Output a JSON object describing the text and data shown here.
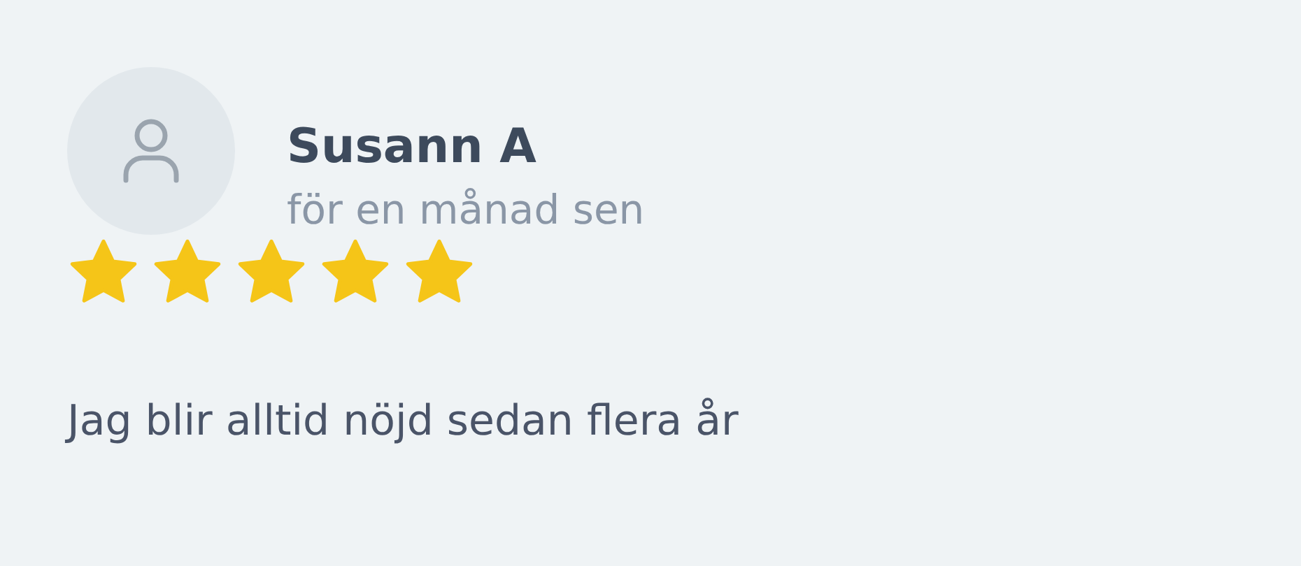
{
  "review": {
    "author": "Susann A",
    "time": "för en månad sen",
    "stars": 5,
    "text": "Jag blir alltid nöjd sedan flera år"
  }
}
